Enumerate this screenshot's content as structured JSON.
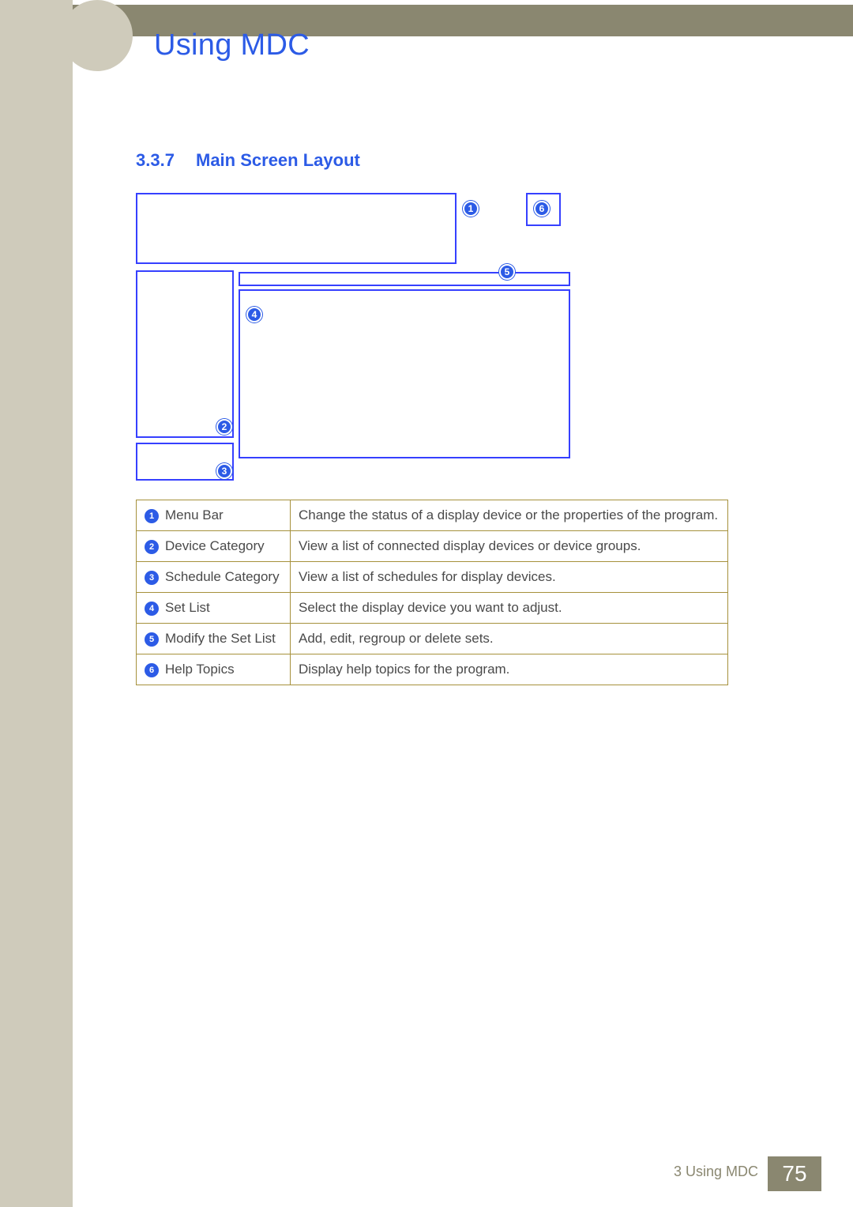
{
  "header": {
    "title": "Using MDC"
  },
  "section": {
    "number": "3.3.7",
    "title": "Main Screen Layout"
  },
  "diagram_callouts": {
    "n1": "1",
    "n2": "2",
    "n3": "3",
    "n4": "4",
    "n5": "5",
    "n6": "6"
  },
  "legend": [
    {
      "num": "1",
      "label": "Menu Bar",
      "desc": "Change the status of a display device or the properties of the program."
    },
    {
      "num": "2",
      "label": "Device Category",
      "desc": "View a list of connected display devices or device groups."
    },
    {
      "num": "3",
      "label": "Schedule Category",
      "desc": "View a list of schedules for display devices."
    },
    {
      "num": "4",
      "label": "Set List",
      "desc": "Select the display device you want to adjust."
    },
    {
      "num": "5",
      "label": "Modify the Set List",
      "desc": "Add, edit, regroup or delete sets."
    },
    {
      "num": "6",
      "label": "Help Topics",
      "desc": "Display help topics for the program."
    }
  ],
  "footer": {
    "chapter": "3 Using MDC",
    "page": "75"
  }
}
